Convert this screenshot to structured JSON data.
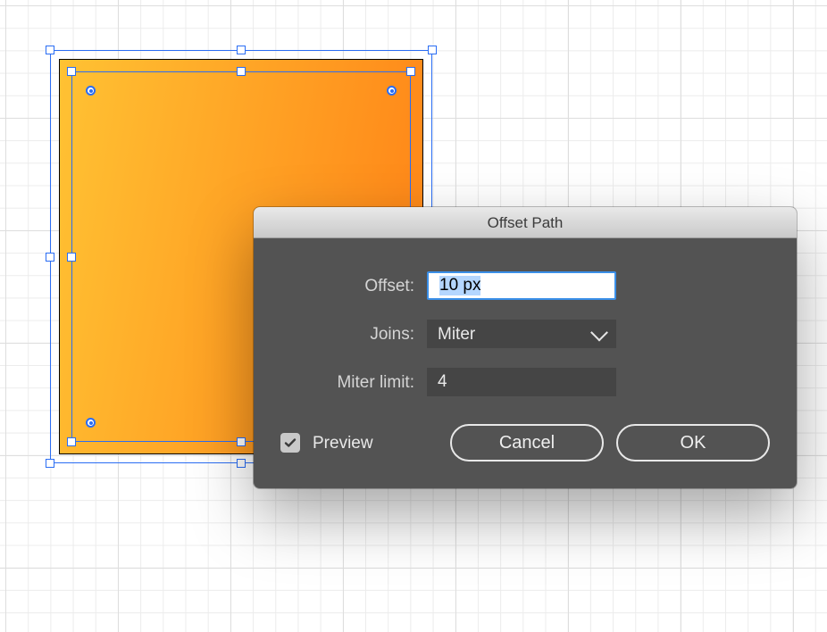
{
  "dialog": {
    "title": "Offset Path",
    "offset_label": "Offset:",
    "offset_value": "10 px",
    "joins_label": "Joins:",
    "joins_value": "Miter",
    "miter_label": "Miter limit:",
    "miter_value": "4",
    "preview_label": "Preview",
    "preview_checked": true,
    "cancel_label": "Cancel",
    "ok_label": "OK"
  },
  "canvas": {
    "selection_color": "#2a6df4",
    "shape_gradient_from": "#ffc233",
    "shape_gradient_to": "#ff8b1a"
  }
}
